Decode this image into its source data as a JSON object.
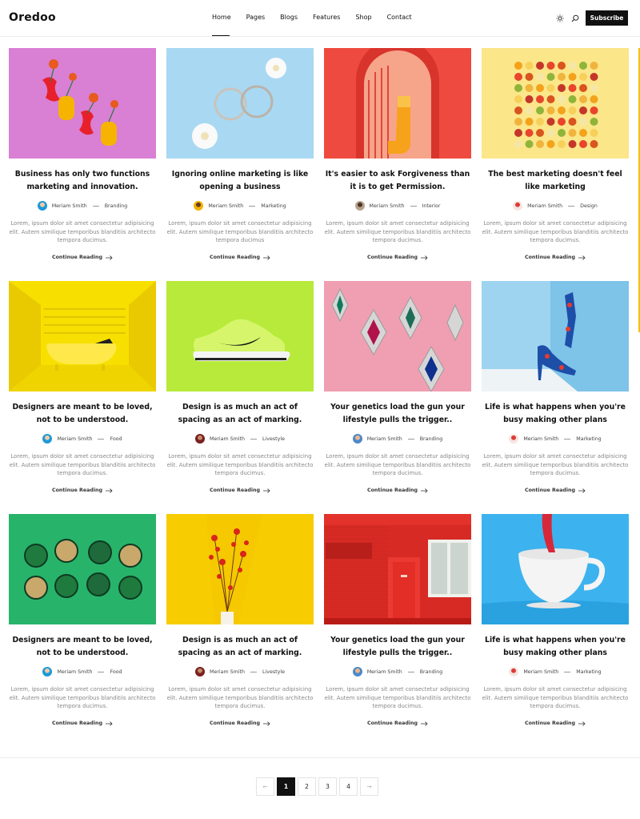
{
  "header": {
    "logo": "Oredoo",
    "nav": [
      "Home",
      "Pages",
      "Blogs",
      "Features",
      "Shop",
      "Contact"
    ],
    "active_nav": "Home",
    "subscribe_label": "Subscribe",
    "icons": [
      "sun-icon",
      "search-icon"
    ]
  },
  "posts": [
    {
      "title": "Business has only two functions marketing and innovation.",
      "author": "Meriam Smith",
      "category": "Branding",
      "excerpt": "Lorem, ipsum dolor sit amet consectetur adipisicing elit. Autem similique temporibus blanditiis architecto tempora ducimus.",
      "cta": "Continue Reading",
      "image": "vases-flowers"
    },
    {
      "title": "Ignoring online marketing is like opening a business",
      "author": "Meriam Smith",
      "category": "Marketing",
      "excerpt": "Lorem, ipsum dolor sit amet consectetur adipisicing elit. Autem similique temporibus blanditiis architecto tempora ducimus",
      "cta": "Continue Reading",
      "image": "hoop-earrings"
    },
    {
      "title": "It's easier to ask Forgiveness than it is to get Permission.",
      "author": "Meriam Smith",
      "category": "Interior",
      "excerpt": "Lorem, ipsum dolor sit amet consectetur adipisicing elit. Autem similique temporibus blanditiis architecto tempora ducimus.",
      "cta": "Continue Reading",
      "image": "arch-doorway"
    },
    {
      "title": "The best marketing doesn't feel like marketing",
      "author": "Meriam Smith",
      "category": "Design",
      "excerpt": "Lorem, ipsum dolor sit amet consectetur adipisicing elit. Autem similique temporibus blanditiis architecto tempora ducimus.",
      "cta": "Continue Reading",
      "image": "fruit-pattern"
    },
    {
      "title": "Designers are meant to be loved, not to be understood.",
      "author": "Meriam Smith",
      "category": "Food",
      "excerpt": "Lorem, ipsum dolor sit amet consectetur adipisicing elit. Autem similique temporibus blanditiis architecto tempora ducimus.",
      "cta": "Continue Reading",
      "image": "yellow-bathtub"
    },
    {
      "title": "Design is as much an act of spacing as an act of marking.",
      "author": "Meriam Smith",
      "category": "Livestyle",
      "excerpt": "Lorem, ipsum dolor sit amet consectetur adipisicing elit. Autem similique temporibus blanditiis architecto tempora ducimus.",
      "cta": "Continue Reading",
      "image": "green-sneaker"
    },
    {
      "title": "Your genetics load the gun your lifestyle pulls the trigger..",
      "author": "Meriam Smith",
      "category": "Branding",
      "excerpt": "Lorem, ipsum dolor sit amet consectetur adipisicing elit. Autem similique temporibus blanditiis architecto tempora ducimus.",
      "cta": "Continue Reading",
      "image": "jewel-earrings"
    },
    {
      "title": "Life is what happens when you're busy making other plans",
      "author": "Meriam Smith",
      "category": "Marketing",
      "excerpt": "Lorem, ipsum dolor sit amet consectetur adipisicing elit. Autem similique temporibus blanditiis architecto tempora ducimus.",
      "cta": "Continue Reading",
      "image": "blue-heels"
    },
    {
      "title": "Designers are meant to be loved, not to be understood.",
      "author": "Meriam Smith",
      "category": "Food",
      "excerpt": "Lorem, ipsum dolor sit amet consectetur adipisicing elit. Autem similique temporibus blanditiis architecto tempora ducimus.",
      "cta": "Continue Reading",
      "image": "coins-green"
    },
    {
      "title": "Design is as much an act of spacing as an act of marking.",
      "author": "Meriam Smith",
      "category": "Livestyle",
      "excerpt": "Lorem, ipsum dolor sit amet consectetur adipisicing elit. Autem similique temporibus blanditiis architecto tempora ducimus.",
      "cta": "Continue Reading",
      "image": "dried-flowers"
    },
    {
      "title": "Your genetics load the gun your lifestyle pulls the trigger..",
      "author": "Meriam Smith",
      "category": "Branding",
      "excerpt": "Lorem, ipsum dolor sit amet consectetur adipisicing elit. Autem similique temporibus blanditiis architecto tempora ducimus.",
      "cta": "Continue Reading",
      "image": "red-brick-wall"
    },
    {
      "title": "Life is what happens when you're busy making other plans",
      "author": "Meriam Smith",
      "category": "Marketing",
      "excerpt": "Lorem, ipsum dolor sit amet consectetur adipisicing elit. Autem similique temporibus blanditiis architecto tempora ducimus.",
      "cta": "Continue Reading",
      "image": "white-cup"
    }
  ],
  "pagination": {
    "prev": "←",
    "pages": [
      "1",
      "2",
      "3",
      "4"
    ],
    "current": "1",
    "next": "→"
  }
}
